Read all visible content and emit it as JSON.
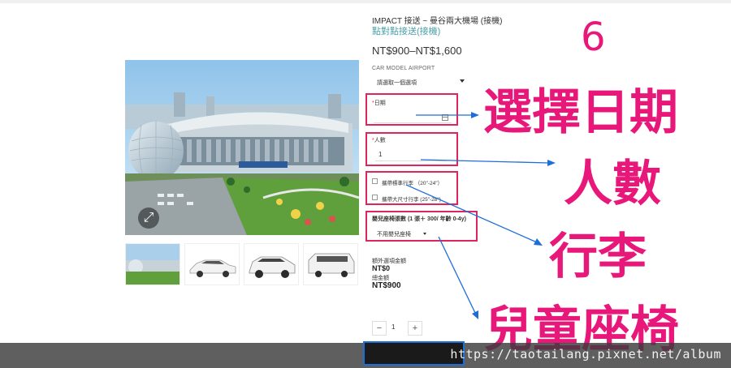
{
  "product": {
    "title": "IMPACT 接送 ~ 曼谷兩大機場 (接機)",
    "subtitle": "點對點接送(接機)",
    "price": "NT$900–NT$1,600"
  },
  "car_model": {
    "label": "CAR MODEL AIRPORT",
    "placeholder": "請選取一個選項"
  },
  "date_field": {
    "label": "日期",
    "required_mark": "*",
    "value": ""
  },
  "people_field": {
    "label": "人數",
    "required_mark": "*",
    "value": "1"
  },
  "luggage": {
    "standard": "攜帶標準行李 （20\"-24\"）",
    "large": "攜帶大尺寸行李 (25\"-28\")"
  },
  "child_seat": {
    "label": "嬰兒座椅張數 (1 張＋ 300/ 年齡 0-4y)",
    "selected": "不用嬰兒座椅"
  },
  "summary": {
    "extra_label": "額外選項金額",
    "extra_value": "NT$0",
    "total_label": "總金額",
    "total_value": "NT$900"
  },
  "quantity": {
    "minus": "−",
    "value": "1",
    "plus": "+"
  },
  "annotations": {
    "step_number": "6",
    "select_date": "選擇日期",
    "people": "人數",
    "luggage": "行李",
    "child_seat": "兒童座椅"
  },
  "watermark": "https://taotailang.pixnet.net/album",
  "colors": {
    "annotation_pink": "#e8177a",
    "box_pink": "#e0245e",
    "arrow_blue": "#1e6ed8",
    "subtitle_teal": "#4aa0a6"
  }
}
